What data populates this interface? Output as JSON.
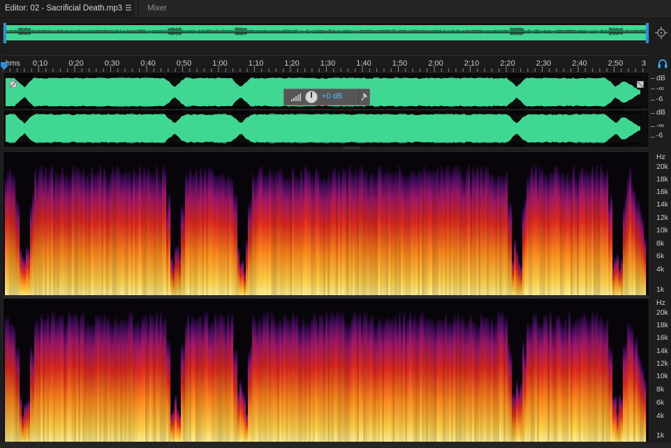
{
  "editor_tabs": {
    "active_label": "Editor: 02 - Sacrificial Death.mp3",
    "menu_glyph": "☰",
    "mixer_label": "Mixer"
  },
  "timeline": {
    "unit_label": "hms",
    "ticks": [
      "0:10",
      "0:20",
      "0:30",
      "0:40",
      "0:50",
      "1:00",
      "1:10",
      "1:20",
      "1:30",
      "1:40",
      "1:50",
      "2:00",
      "2:10",
      "2:20",
      "2:30",
      "2:40",
      "2:50",
      "3"
    ]
  },
  "waveform": {
    "color": "#40d793",
    "peak_color": "#000000"
  },
  "hud": {
    "volume_value": "+0 dB"
  },
  "db_scale": {
    "unit": "dB",
    "labels": [
      "dB",
      "-∞",
      "-6",
      "dB",
      "-∞",
      "-6"
    ]
  },
  "frequency_scale": {
    "unit": "Hz",
    "labels": [
      "20k",
      "18k",
      "16k",
      "14k",
      "12k",
      "10k",
      "8k",
      "6k",
      "4k",
      "1k"
    ]
  },
  "icons": {
    "zoom": "zoom-crosshair-icon",
    "headphones": "headphones-icon",
    "pin": "pin-icon",
    "signal": "signal-bars-icon",
    "knob": "volume-knob-icon"
  }
}
